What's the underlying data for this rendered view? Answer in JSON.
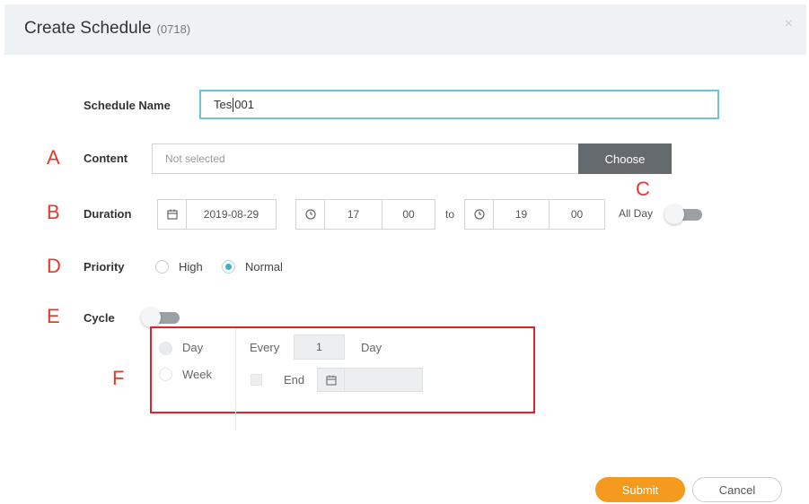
{
  "dialog": {
    "title": "Create Schedule",
    "title_id": "(0718)",
    "close_glyph": "×"
  },
  "schedule_name": {
    "label": "Schedule Name",
    "value_before_caret": "Tes",
    "value_after_caret": "001"
  },
  "content": {
    "label": "Content",
    "placeholder": "Not selected",
    "choose_label": "Choose"
  },
  "duration": {
    "label": "Duration",
    "date": "2019-08-29",
    "start_hour": "17",
    "start_minute": "00",
    "to_label": "to",
    "end_hour": "19",
    "end_minute": "00",
    "all_day_label": "All Day",
    "all_day_on": false
  },
  "priority": {
    "label": "Priority",
    "options": [
      "High",
      "Normal"
    ],
    "selected": "Normal"
  },
  "cycle": {
    "label": "Cycle",
    "enabled": false,
    "type_options": [
      "Day",
      "Week"
    ],
    "every_label": "Every",
    "every_value": "1",
    "unit_label": "Day",
    "end_label": "End",
    "end_value": ""
  },
  "markers": {
    "a": "A",
    "b": "B",
    "c": "C",
    "d": "D",
    "e": "E",
    "f": "F"
  },
  "footer": {
    "submit_label": "Submit",
    "cancel_label": "Cancel"
  },
  "icons": {
    "calendar": "calendar-icon",
    "clock": "clock-icon"
  },
  "colors": {
    "accent_teal": "#3fb0c9",
    "submit_orange": "#f39a1f",
    "choose_dark": "#646a6e",
    "annotation_red": "#d8262c"
  }
}
